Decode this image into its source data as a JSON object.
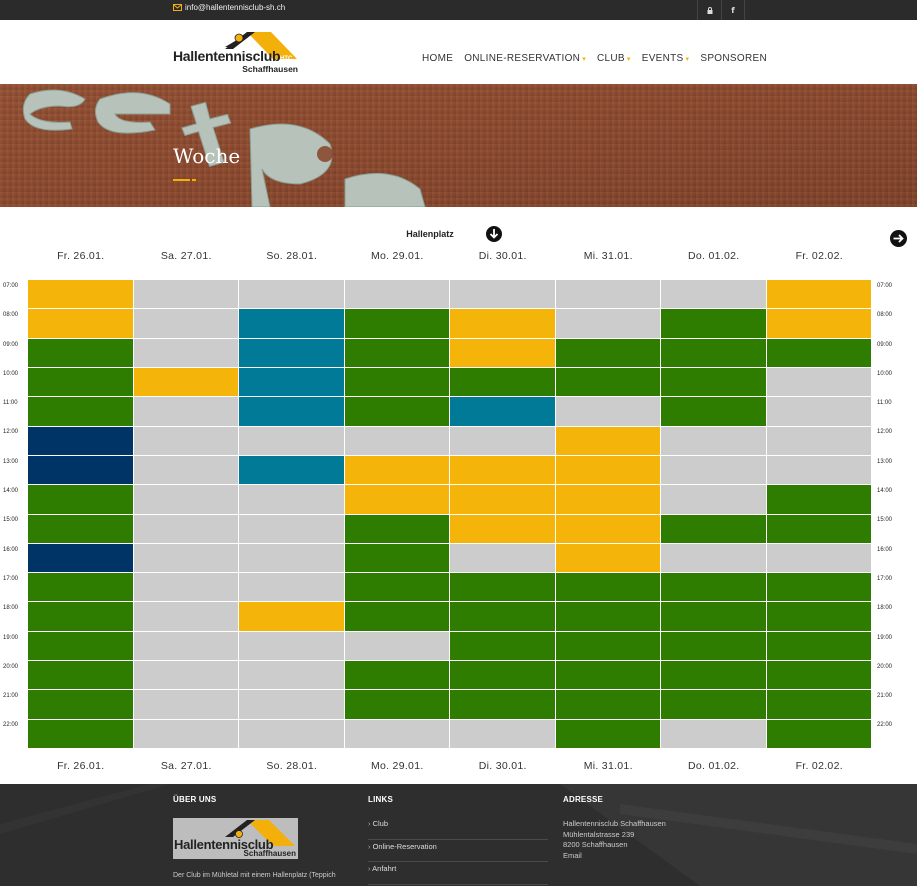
{
  "topbar": {
    "email": "info@hallentennisclub-sh.ch",
    "icons": [
      "lock-icon",
      "facebook-icon"
    ]
  },
  "header": {
    "logo_name": "Hallentennisclub",
    "logo_sub": "Schaffhausen",
    "logo_badge": "HTC",
    "nav": [
      {
        "label": "HOME",
        "dropdown": false
      },
      {
        "label": "ONLINE-RESERVATION",
        "dropdown": true
      },
      {
        "label": "CLUB",
        "dropdown": true
      },
      {
        "label": "EVENTS",
        "dropdown": true
      },
      {
        "label": "SPONSOREN",
        "dropdown": false
      }
    ]
  },
  "hero": {
    "title": "Woche"
  },
  "schedule": {
    "court": "Hallenplatz",
    "days": [
      "Fr. 26.01.",
      "Sa. 27.01.",
      "So. 28.01.",
      "Mo. 29.01.",
      "Di. 30.01.",
      "Mi. 31.01.",
      "Do. 01.02.",
      "Fr. 02.02."
    ],
    "times": [
      "07:00",
      "08:00",
      "09:00",
      "10:00",
      "11:00",
      "12:00",
      "13:00",
      "14:00",
      "15:00",
      "16:00",
      "17:00",
      "18:00",
      "19:00",
      "20:00",
      "21:00",
      "22:00"
    ],
    "colors": {
      "Y": "#f5b40a",
      "G": "#2e7d00",
      "T": "#007a96",
      "N": "#003366",
      "L": "#cccccc"
    },
    "grid": [
      [
        "Y",
        "L",
        "L",
        "L",
        "L",
        "L",
        "L",
        "Y"
      ],
      [
        "Y",
        "L",
        "T",
        "G",
        "Y",
        "L",
        "G",
        "Y"
      ],
      [
        "G",
        "L",
        "T",
        "G",
        "Y",
        "G",
        "G",
        "G"
      ],
      [
        "G",
        "Y",
        "T",
        "G",
        "G",
        "G",
        "G",
        "L"
      ],
      [
        "G",
        "L",
        "T",
        "G",
        "T",
        "L",
        "G",
        "L"
      ],
      [
        "N",
        "L",
        "L",
        "L",
        "L",
        "Y",
        "L",
        "L"
      ],
      [
        "N",
        "L",
        "T",
        "Y",
        "Y",
        "Y",
        "L",
        "L"
      ],
      [
        "G",
        "L",
        "L",
        "Y",
        "Y",
        "Y",
        "L",
        "G"
      ],
      [
        "G",
        "L",
        "L",
        "G",
        "Y",
        "Y",
        "G",
        "G"
      ],
      [
        "N",
        "L",
        "L",
        "G",
        "L",
        "Y",
        "L",
        "L"
      ],
      [
        "G",
        "L",
        "L",
        "G",
        "G",
        "G",
        "G",
        "G"
      ],
      [
        "G",
        "L",
        "Y",
        "G",
        "G",
        "G",
        "G",
        "G"
      ],
      [
        "G",
        "L",
        "L",
        "L",
        "G",
        "G",
        "G",
        "G"
      ],
      [
        "G",
        "L",
        "L",
        "G",
        "G",
        "G",
        "G",
        "G"
      ],
      [
        "G",
        "L",
        "L",
        "G",
        "G",
        "G",
        "G",
        "G"
      ],
      [
        "G",
        "L",
        "L",
        "L",
        "L",
        "G",
        "L",
        "G"
      ]
    ]
  },
  "footer": {
    "about_title": "ÜBER UNS",
    "about_text": "Der Club im Mühletal mit einem Hallenplatz (Teppich",
    "links_title": "LINKS",
    "links": [
      "Club",
      "Online-Reservation",
      "Anfahrt"
    ],
    "address_title": "ADRESSE",
    "address_lines": [
      "Hallentennisclub Schaffhausen",
      "Mühlentalstrasse 239",
      "8200 Schaffhausen",
      "Email"
    ],
    "logo_name": "Hallentennisclub",
    "logo_sub": "Schaffhausen"
  }
}
